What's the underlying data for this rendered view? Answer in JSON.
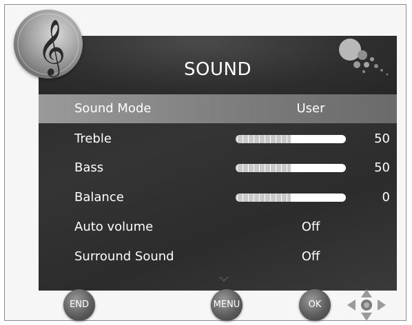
{
  "menu": {
    "title": "SOUND",
    "rows": [
      {
        "label": "Sound Mode",
        "value": "User"
      },
      {
        "label": "Treble",
        "value": "50",
        "level": 0.5
      },
      {
        "label": "Bass",
        "value": "50",
        "level": 0.5
      },
      {
        "label": "Balance",
        "value": "0",
        "level": 0.5
      },
      {
        "label": "Auto volume",
        "value": "Off"
      },
      {
        "label": "Surround Sound",
        "value": "Off"
      }
    ]
  },
  "buttons": {
    "end": "END",
    "menu": "MENU",
    "ok": "OK"
  },
  "icons": {
    "logo": "treble-clef-icon",
    "decoration": "bubbles-icon",
    "navigation": "dpad-arrows-icon",
    "scroll": "chevron-down-icon"
  },
  "colors": {
    "panel": "#2e2e2e",
    "selected_row": "#8a8a8a",
    "text": "#ffffff",
    "button": "#5d5d5d"
  }
}
